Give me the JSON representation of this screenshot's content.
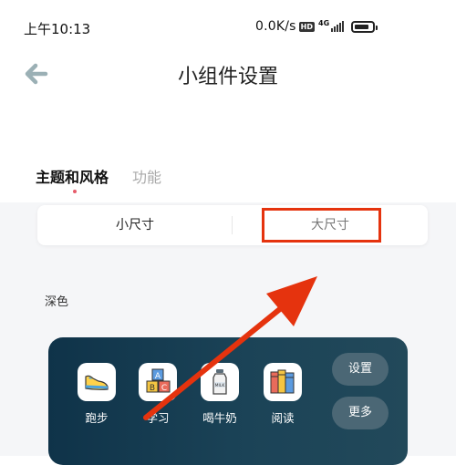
{
  "status_bar": {
    "time": "上午10:13",
    "speed": "0.0K/s",
    "hd": "HD",
    "network": "4G",
    "battery_level": 0.85
  },
  "header": {
    "title": "小组件设置",
    "back_icon": "back-arrow-icon"
  },
  "tabs": [
    {
      "label": "主题和风格",
      "active": true
    },
    {
      "label": "功能",
      "active": false
    }
  ],
  "size_toggle": {
    "small_label": "小尺寸",
    "large_label": "大尺寸",
    "selected": "小尺寸",
    "highlighted": "大尺寸"
  },
  "section": {
    "label": "深色"
  },
  "widget": {
    "apps": [
      {
        "label": "跑步",
        "icon": "running-shoe-icon"
      },
      {
        "label": "学习",
        "icon": "abc-blocks-icon"
      },
      {
        "label": "喝牛奶",
        "icon": "milk-bottle-icon"
      },
      {
        "label": "阅读",
        "icon": "books-icon"
      }
    ],
    "buttons": {
      "settings": "设置",
      "more": "更多"
    }
  },
  "colors": {
    "annotation_red": "#e5330e",
    "widget_dark": "#0f3349",
    "tab_dot": "#e65b6a",
    "back_arrow": "#9bb0b5"
  }
}
